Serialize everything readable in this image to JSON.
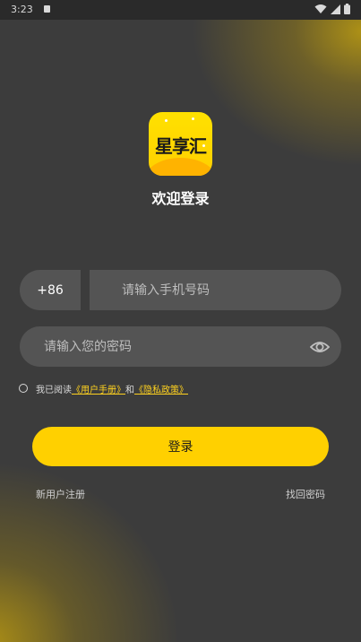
{
  "status_bar": {
    "time": "3:23"
  },
  "app": {
    "logo_text": "星享汇",
    "welcome": "欢迎登录"
  },
  "form": {
    "country_code": "+86",
    "phone_placeholder": "请输入手机号码",
    "password_placeholder": "请输入您的密码",
    "agreement": {
      "prefix": "我已阅读",
      "user_manual": "《用户手册》",
      "and": "和",
      "privacy_policy": "《隐私政策》",
      "checked": false
    },
    "login_label": "登录"
  },
  "footer": {
    "register_label": "新用户注册",
    "forgot_label": "找回密码"
  },
  "colors": {
    "accent": "#ffd000",
    "link": "#ffd21f",
    "background": "#3c3c3c",
    "field": "#545454"
  },
  "icons": [
    "wifi-icon",
    "signal-icon",
    "battery-icon",
    "eye-icon",
    "notification-icon"
  ]
}
